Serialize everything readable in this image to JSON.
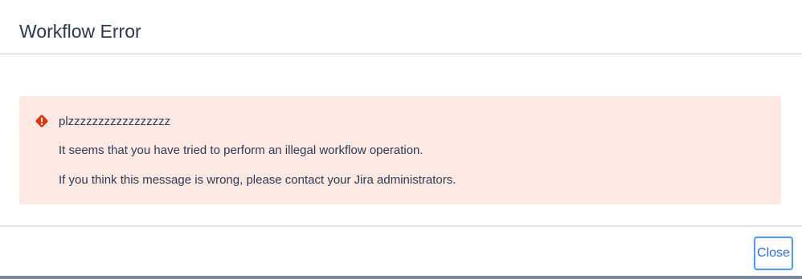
{
  "dialog": {
    "title": "Workflow Error"
  },
  "error": {
    "icon": "error-icon",
    "icon_color": "#de350b",
    "background": "#fde9e4",
    "title": "plzzzzzzzzzzzzzzzzz",
    "lines": [
      "It seems that you have tried to perform an illegal workflow operation.",
      "If you think this message is wrong, please contact your Jira administrators."
    ]
  },
  "footer": {
    "close_label": "Close",
    "accent": "#4c9aff"
  }
}
